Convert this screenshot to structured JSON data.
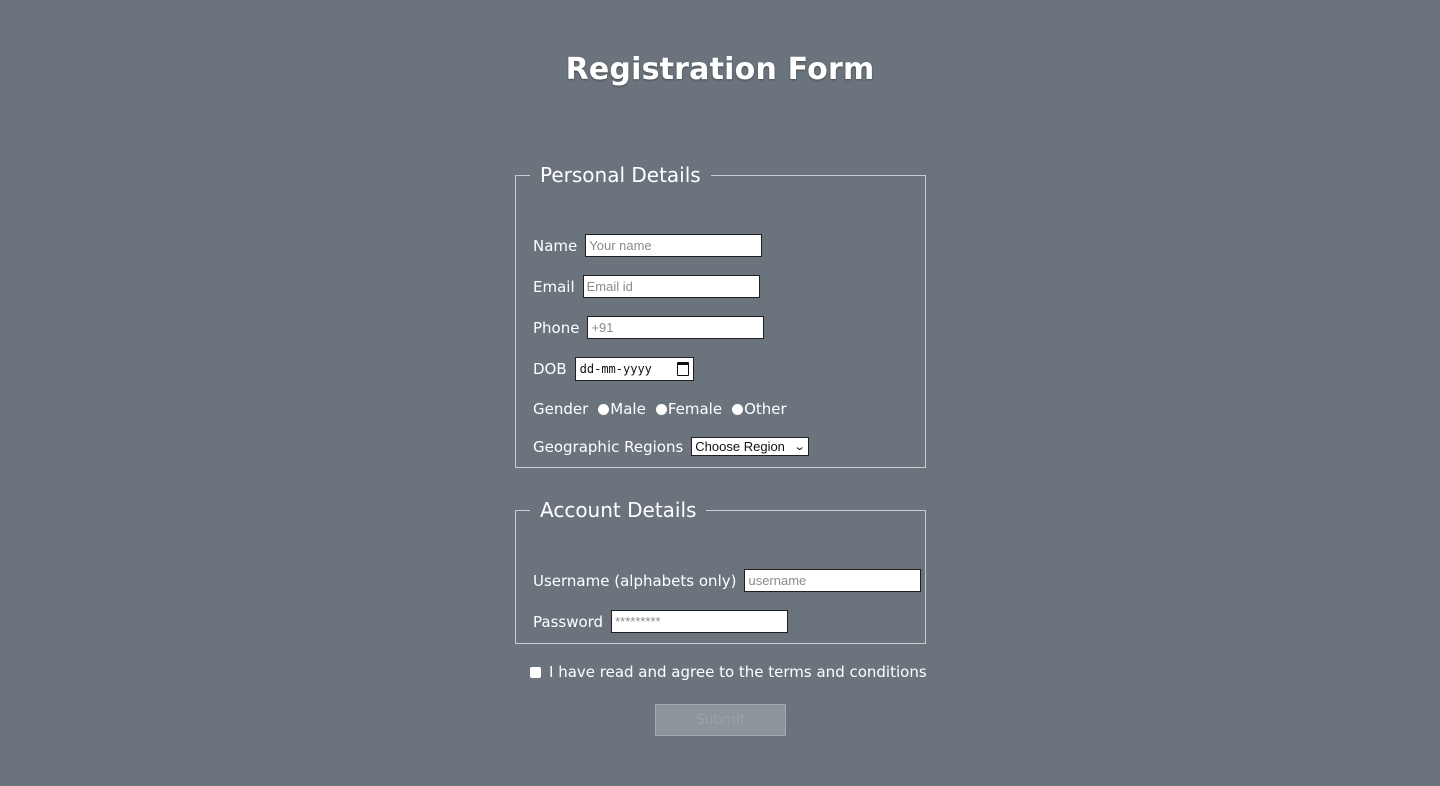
{
  "page": {
    "title": "Registration Form",
    "background": "#6b747d"
  },
  "personal": {
    "legend": "Personal Details",
    "name_label": "Name",
    "name_placeholder": "Your name",
    "email_label": "Email",
    "email_placeholder": "Email id",
    "phone_label": "Phone",
    "phone_placeholder": "+91",
    "dob_label": "DOB",
    "dob_placeholder": "dd-mm-yyyy",
    "gender_label": "Gender",
    "gender_options": [
      "Male",
      "Female",
      "Other"
    ],
    "region_label": "Geographic Regions",
    "region_selected": "Choose Region"
  },
  "account": {
    "legend": "Account Details",
    "username_label": "Username (alphabets only)",
    "username_placeholder": "username",
    "password_label": "Password",
    "password_placeholder": "*********"
  },
  "terms": {
    "label": "I have read and agree to the terms and conditions",
    "checked": false
  },
  "submit": {
    "label": "Submit",
    "enabled": false
  },
  "icons": {
    "calendar": "calendar-icon",
    "dropdown": "chevron-down-icon"
  }
}
